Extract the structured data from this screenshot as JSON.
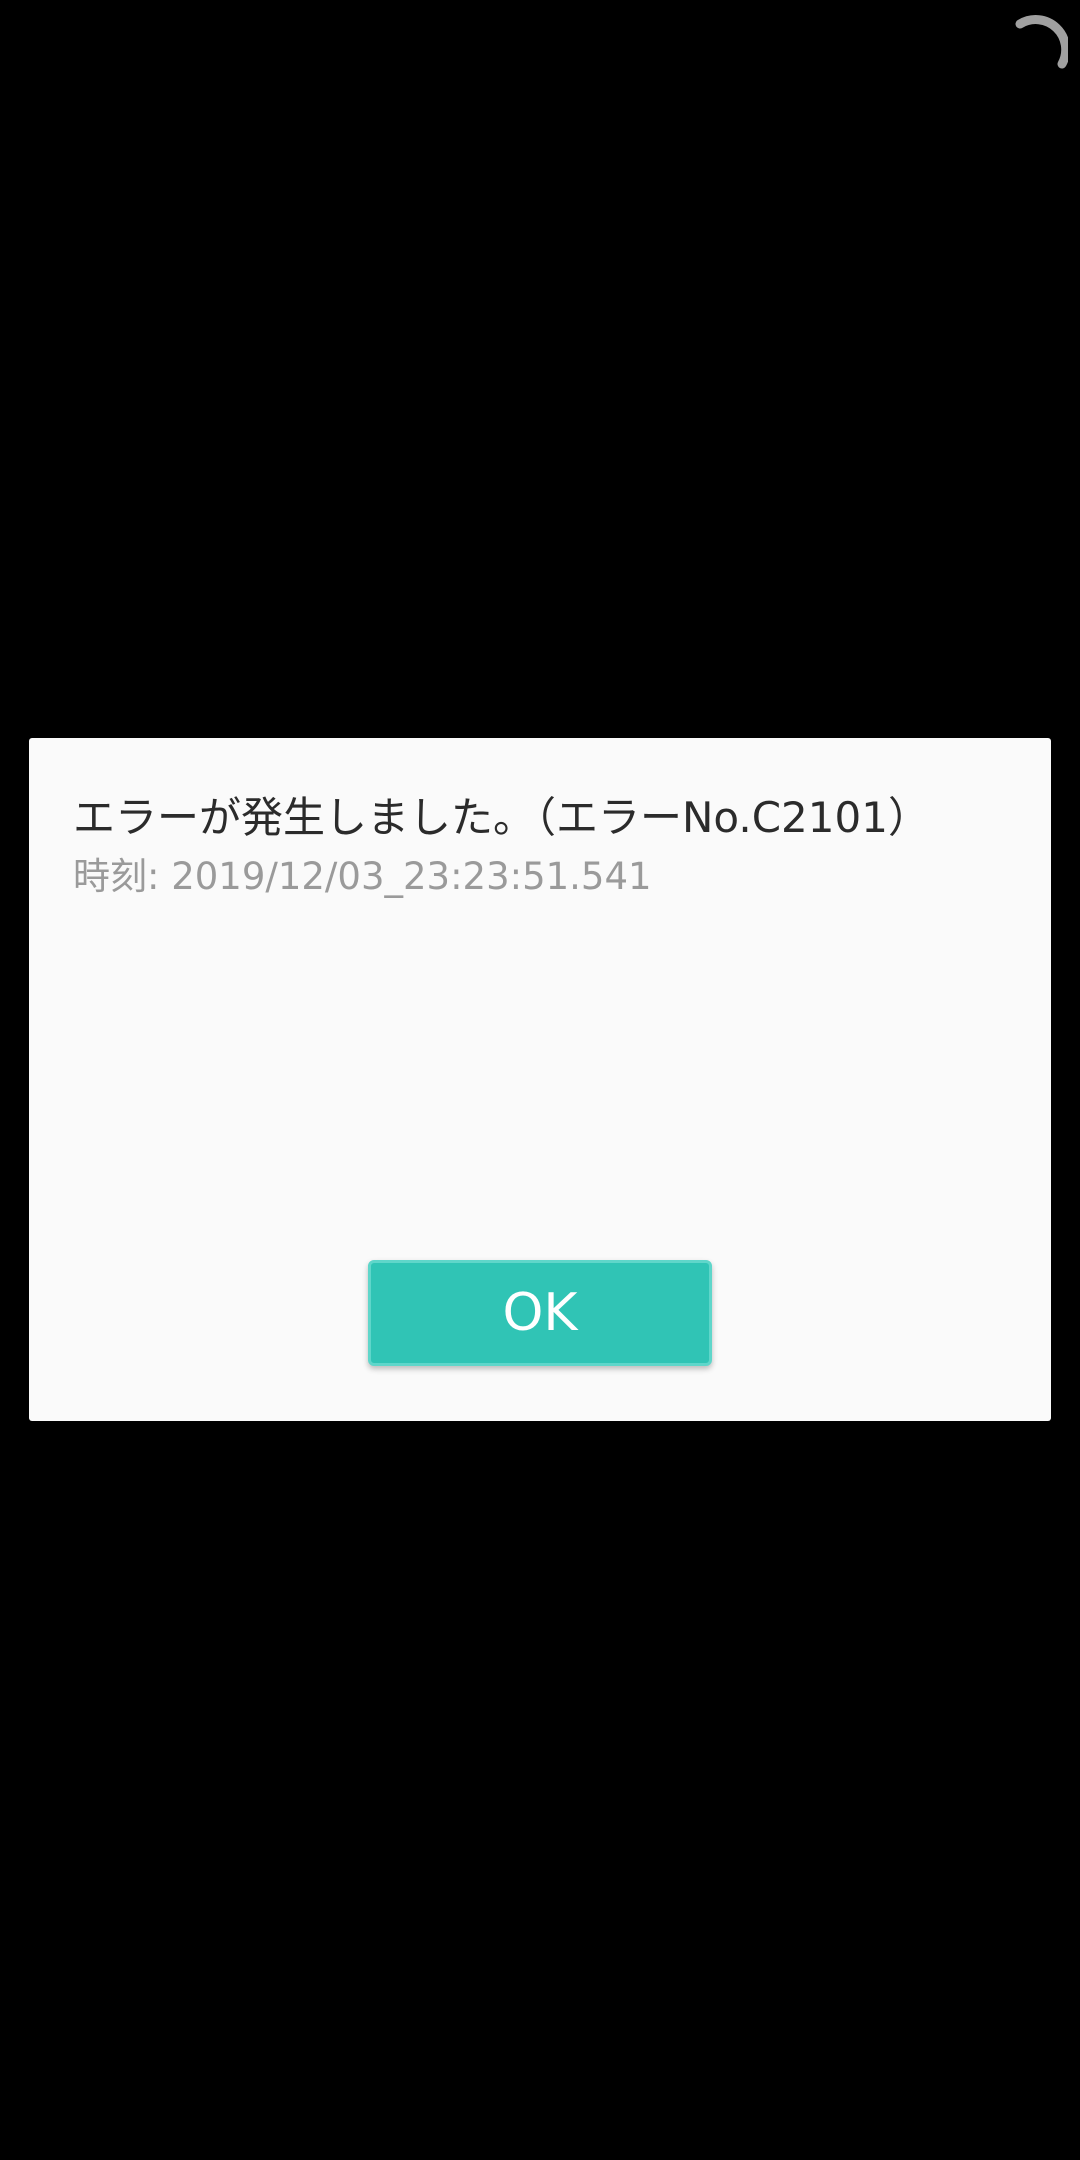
{
  "status": {
    "spinner_icon": "loading-arc-icon",
    "spinner_color": "#a0a0a0"
  },
  "dialog": {
    "message": "エラーが発生しました。（エラーNo.C2101）",
    "timestamp": "時刻: 2019/12/03_23:23:51.541",
    "ok_label": "OK",
    "ok_color": "#30c4b5",
    "background_color": "#fafafa"
  }
}
